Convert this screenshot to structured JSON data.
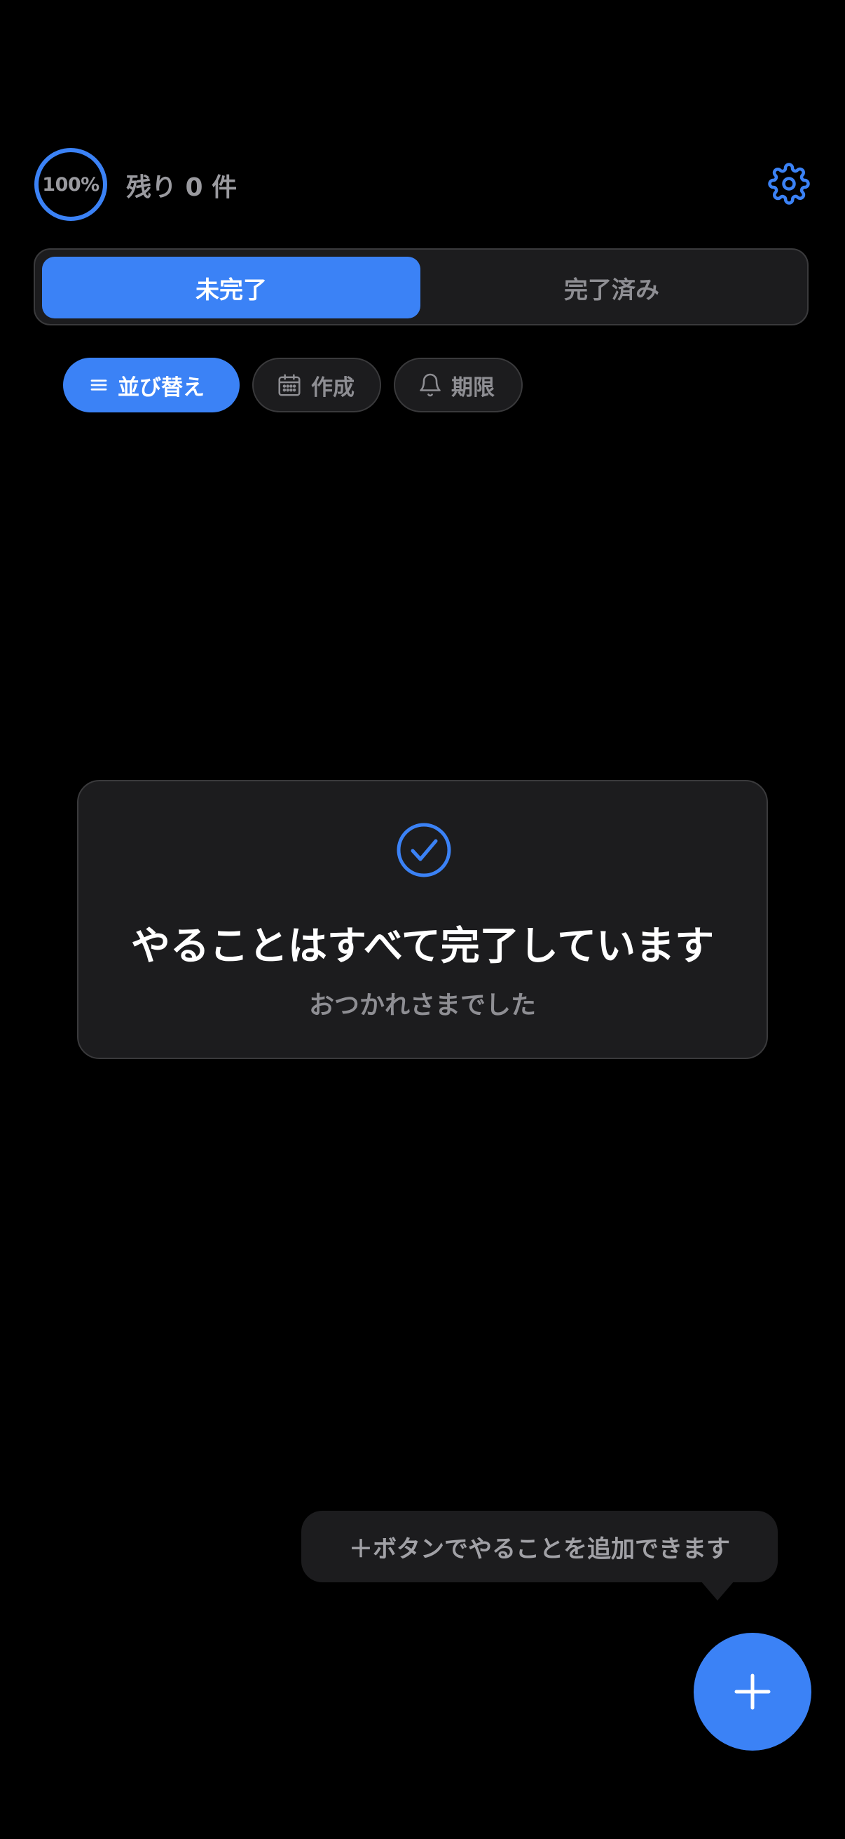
{
  "header": {
    "progress_label": "100%",
    "progress_fraction": 1.0,
    "remaining_text": "残り 0 件",
    "settings_icon": "gear-icon"
  },
  "tabs": [
    {
      "label": "未完了",
      "selected": true
    },
    {
      "label": "完了済み",
      "selected": false
    }
  ],
  "filters": [
    {
      "label": "並び替え",
      "icon": "list-icon",
      "active": true
    },
    {
      "label": "作成",
      "icon": "calendar-icon",
      "active": false
    },
    {
      "label": "期限",
      "icon": "bell-icon",
      "active": false
    }
  ],
  "empty_state": {
    "icon": "check-circle-icon",
    "title": "やることはすべて完了しています",
    "subtitle": "おつかれさまでした"
  },
  "tooltip": {
    "text": "＋ボタンでやることを追加できます"
  },
  "fab": {
    "icon": "plus-icon"
  },
  "colors": {
    "accent": "#3b82f6",
    "background": "#000000",
    "surface": "#1c1c1e",
    "border": "#3a3a3c",
    "muted_text": "#8e8e93"
  }
}
